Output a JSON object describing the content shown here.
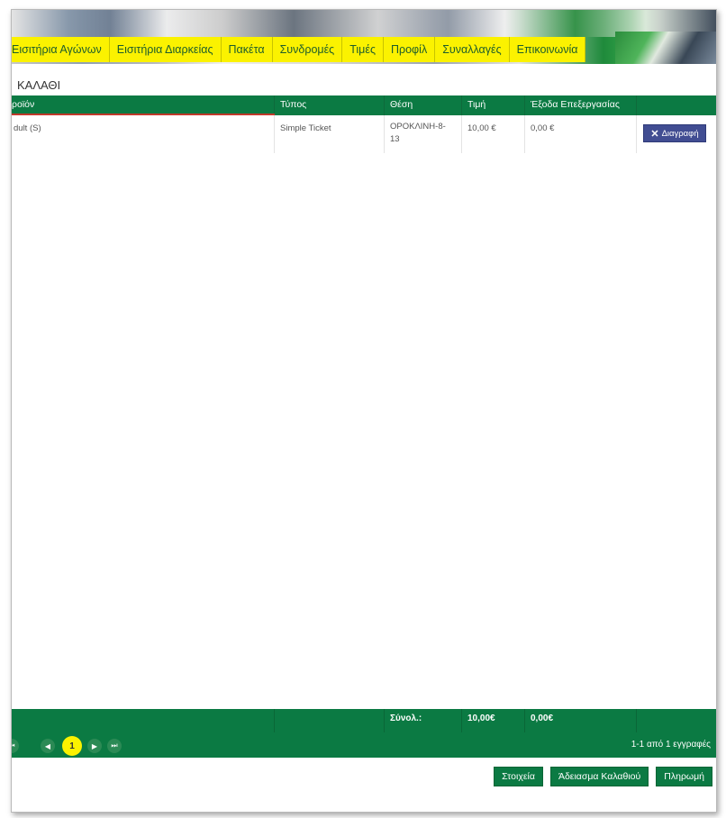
{
  "nav": {
    "items": [
      {
        "label": "Εισιτήρια Αγώνων"
      },
      {
        "label": "Εισιτήρια Διαρκείας"
      },
      {
        "label": "Πακέτα"
      },
      {
        "label": "Συνδρομές"
      },
      {
        "label": "Τιμές"
      },
      {
        "label": "Προφίλ"
      },
      {
        "label": "Συναλλαγές"
      },
      {
        "label": "Επικοινωνία"
      }
    ]
  },
  "page": {
    "title": "ΚΑΛΑΘΙ"
  },
  "grid": {
    "columns": [
      "ροϊόν",
      "Τύπος",
      "Θέση",
      "Τιμή",
      "Έξοδα Επεξεργασίας"
    ],
    "rows": [
      {
        "product": "dult (S)",
        "type": "Simple Ticket",
        "seat_line1": "ΟΡΟΚΛΙΝΗ-8-",
        "seat_line2": "13",
        "price": "10,00 €",
        "fees": "0,00 €",
        "delete_label": "Διαγραφή"
      }
    ],
    "footer": {
      "sum_label": "Σύνολ.:",
      "sum_price": "10,00€",
      "sum_fees": "0,00€"
    },
    "pager": {
      "current_page": "1",
      "info": "1-1 από 1 εγγραφές"
    }
  },
  "actions": {
    "details": "Στοιχεία",
    "empty_cart": "Άδειασμα Καλαθιού",
    "pay": "Πληρωμή"
  },
  "colors": {
    "accent_green": "#0b7a43",
    "nav_yellow": "#fbf200",
    "delete_blue": "#414d92"
  }
}
